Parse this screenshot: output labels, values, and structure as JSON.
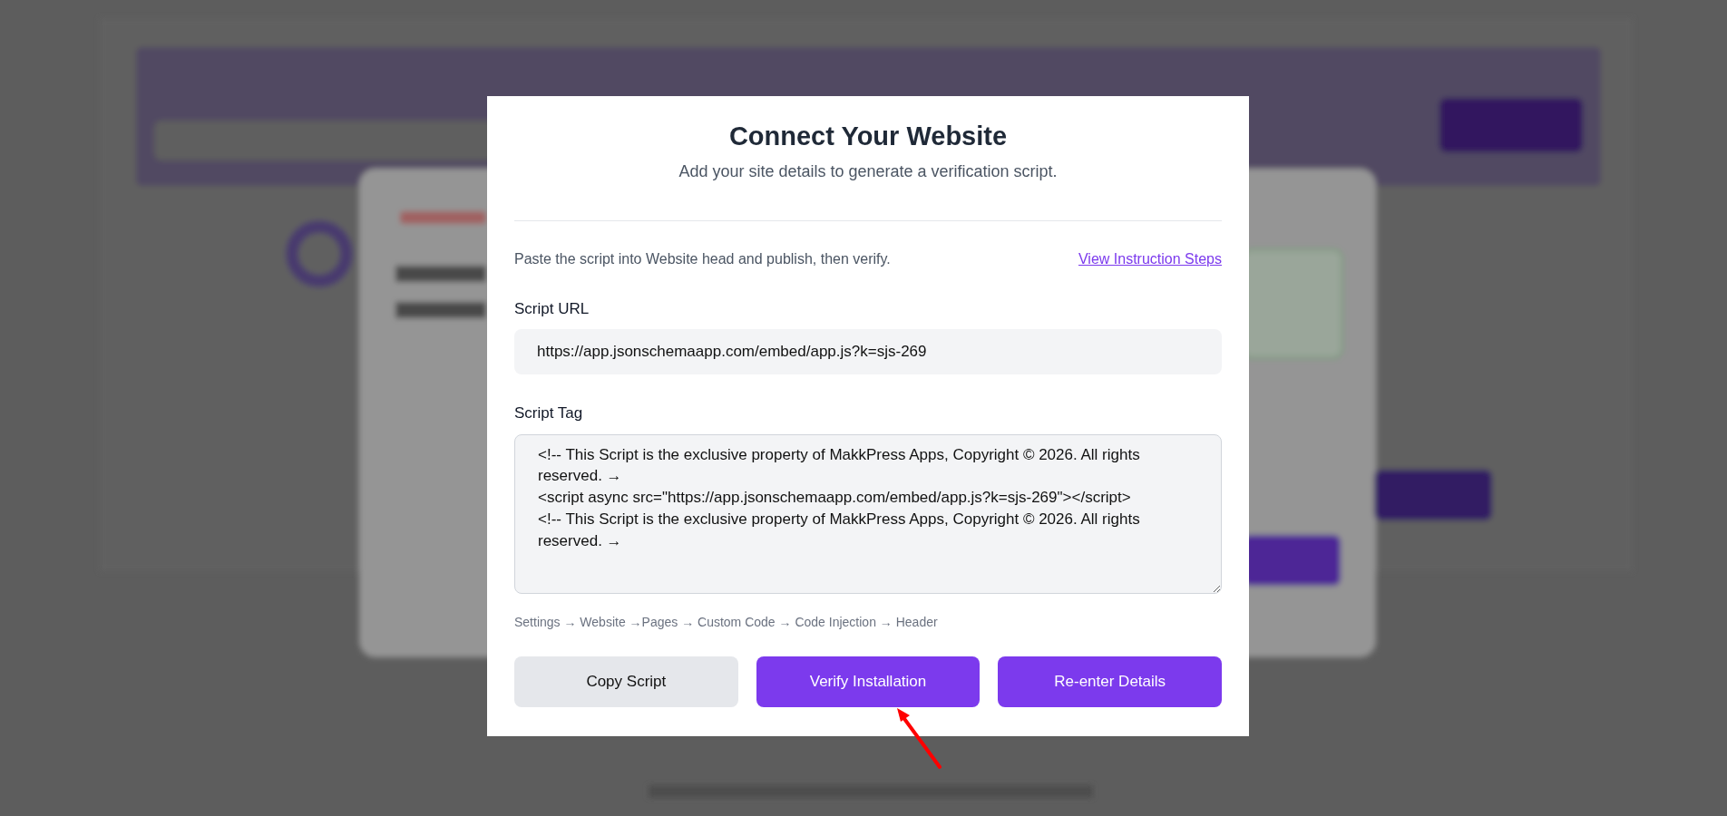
{
  "dialog": {
    "title": "Connect Your Website",
    "subtitle": "Add your site details to generate a verification script.",
    "instruction": "Paste the script into Website head and publish, then verify.",
    "instruction_link": "View Instruction Steps",
    "fields": [
      {
        "kind": "input",
        "label": "Script URL",
        "value": "https://app.jsonschemaapp.com/embed/app.js?k=sjs-269"
      },
      {
        "kind": "textarea",
        "label": "Script Tag",
        "value": "<!-- This Script is the exclusive property of MakkPress Apps, Copyright © 2026. All rights reserved. →\n<script async src=\"https://app.jsonschemaapp.com/embed/app.js?k=sjs-269\"></script>\n<!-- This Script is the exclusive property of MakkPress Apps, Copyright © 2026. All rights reserved. →"
      }
    ],
    "path_hint": "Settings → Website →Pages → Custom Code → Code Injection → Header",
    "buttons": [
      {
        "label": "Copy Script",
        "kind": "secondary"
      },
      {
        "label": "Verify Installation",
        "kind": "primary"
      },
      {
        "label": "Re-enter Details",
        "kind": "primary"
      }
    ]
  }
}
